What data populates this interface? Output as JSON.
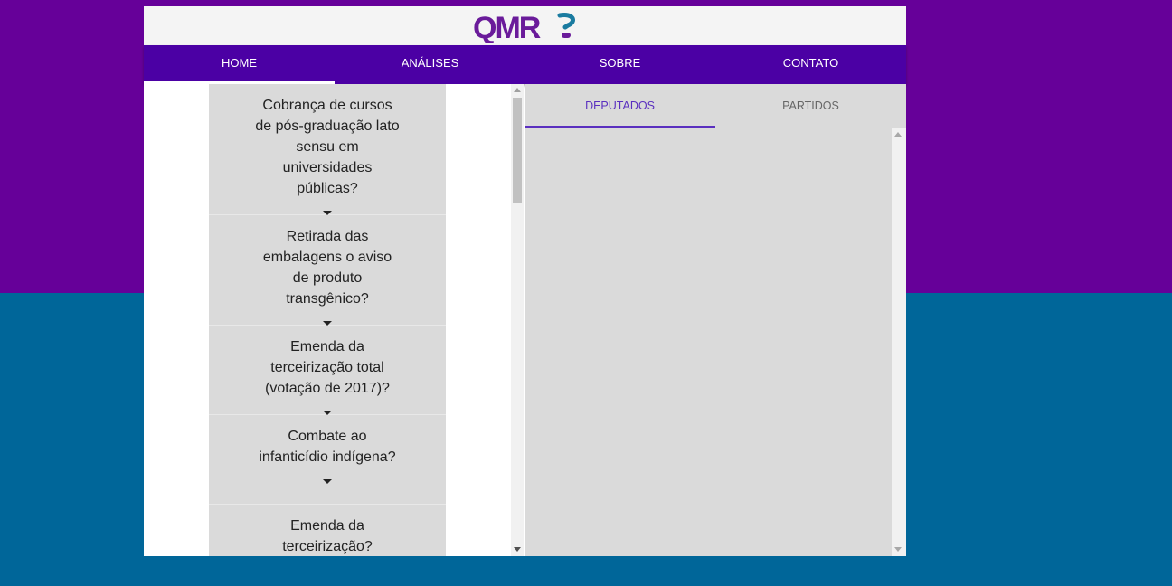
{
  "colors": {
    "background_top": "#660099",
    "background_bottom": "#006699",
    "nav_bar": "#4b00a4",
    "tab_accent": "#5a2fbf",
    "logo_purple": "#6a1b9a",
    "logo_teal": "#1a7ba0"
  },
  "logo": {
    "text": "QMR"
  },
  "nav": {
    "tabs": [
      {
        "label": "HOME",
        "active": true
      },
      {
        "label": "ANÁLISES",
        "active": false
      },
      {
        "label": "SOBRE",
        "active": false
      },
      {
        "label": "CONTATO",
        "active": false
      }
    ]
  },
  "questions": [
    {
      "text": "Cobrança de cursos de pós-graduação lato sensu em universidades públicas?",
      "icon": "caret-down-icon"
    },
    {
      "text": "Retirada das embalagens o aviso de produto transgênico?",
      "icon": "caret-down-icon"
    },
    {
      "text": "Emenda da terceirização total (votação de 2017)?",
      "icon": "caret-down-icon"
    },
    {
      "text": "Combate ao infanticídio indígena?",
      "icon": "caret-down-icon"
    },
    {
      "text": "Emenda da terceirização?",
      "icon": "caret-down-icon"
    }
  ],
  "results": {
    "tabs": [
      {
        "label": "DEPUTADOS",
        "active": true
      },
      {
        "label": "PARTIDOS",
        "active": false
      }
    ]
  }
}
